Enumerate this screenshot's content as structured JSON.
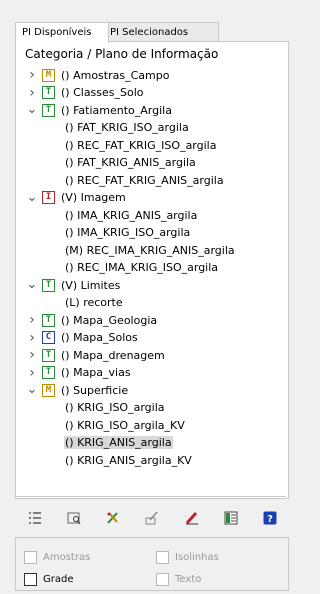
{
  "tabs": [
    {
      "label": "PI Disponíveis",
      "active": true
    },
    {
      "label": "PI Selecionados",
      "active": false
    }
  ],
  "tree": {
    "header": "Categoria / Plano de Informação",
    "rows": [
      {
        "chev": ">",
        "badge": "M",
        "badge_color": "#c08a00",
        "label": "() Amostras_Campo"
      },
      {
        "chev": ">",
        "badge": "T",
        "badge_color": "#2a8a3a",
        "label": "() Classes_Solo"
      },
      {
        "chev": "v",
        "badge": "T",
        "badge_color": "#2a8a3a",
        "label": "() Fatiamento_Argila"
      },
      {
        "chev": "",
        "badge": "",
        "label": "() FAT_KRIG_ISO_argila"
      },
      {
        "chev": "",
        "badge": "",
        "label": "() REC_FAT_KRIG_ISO_argila"
      },
      {
        "chev": "",
        "badge": "",
        "label": "() FAT_KRIG_ANIS_argila"
      },
      {
        "chev": "",
        "badge": "",
        "label": "() REC_FAT_KRIG_ANIS_argila"
      },
      {
        "chev": "v",
        "badge": "I",
        "badge_color": "#c0202a",
        "label": "(V) Imagem"
      },
      {
        "chev": "",
        "badge": "",
        "label": "() IMA_KRIG_ANIS_argila"
      },
      {
        "chev": "",
        "badge": "",
        "label": "() IMA_KRIG_ISO_argila"
      },
      {
        "chev": "",
        "badge": "",
        "label": "(M) REC_IMA_KRIG_ANIS_argila"
      },
      {
        "chev": "",
        "badge": "",
        "label": "() REC_IMA_KRIG_ISO_argila"
      },
      {
        "chev": "v",
        "badge": "T",
        "badge_color": "#2a8a3a",
        "label": "(V) Limites"
      },
      {
        "chev": "",
        "badge": "",
        "label": "(L) recorte"
      },
      {
        "chev": ">",
        "badge": "T",
        "badge_color": "#2a8a3a",
        "label": "() Mapa_Geologia"
      },
      {
        "chev": ">",
        "badge": "C",
        "badge_color": "#2040b0",
        "label": "() Mapa_Solos"
      },
      {
        "chev": ">",
        "badge": "T",
        "badge_color": "#2a8a3a",
        "label": "() Mapa_drenagem"
      },
      {
        "chev": ">",
        "badge": "T",
        "badge_color": "#2a8a3a",
        "label": "() Mapa_vias"
      },
      {
        "chev": "v",
        "badge": "M",
        "badge_color": "#c08a00",
        "label": "() Superficie"
      },
      {
        "chev": "",
        "badge": "",
        "label": "() KRIG_ISO_argila"
      },
      {
        "chev": "",
        "badge": "",
        "label": "() KRIG_ISO_argila_KV"
      },
      {
        "chev": "",
        "badge": "",
        "label": "() KRIG_ANIS_argila",
        "selected": true
      },
      {
        "chev": "",
        "badge": "",
        "label": "() KRIG_ANIS_argila_KV"
      }
    ]
  },
  "toolbar": {
    "icons": [
      "list-icon",
      "zoom-icon",
      "pencil-tool-icon",
      "edit-icon",
      "eraser-icon",
      "legend-icon",
      "help-icon"
    ]
  },
  "options": {
    "amostras": {
      "label": "Amostras",
      "enabled": false,
      "checked": false
    },
    "isolinhas": {
      "label": "Isolinhas",
      "enabled": false,
      "checked": false
    },
    "grade": {
      "label": "Grade",
      "enabled": true,
      "checked": false
    },
    "texto": {
      "label": "Texto",
      "enabled": false,
      "checked": false
    }
  }
}
